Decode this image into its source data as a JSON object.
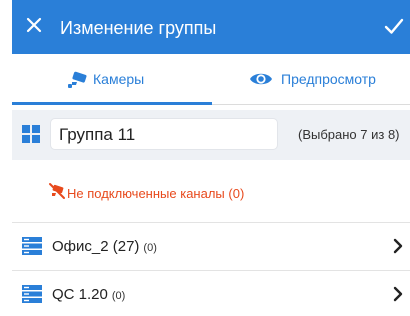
{
  "appbar": {
    "title": "Изменение группы",
    "background": "#2a7fd8"
  },
  "tabs": [
    {
      "label": "Камеры",
      "icon": "camera-icon",
      "selected": true
    },
    {
      "label": "Предпросмотр",
      "icon": "eye-icon",
      "selected": false
    }
  ],
  "group": {
    "name": "Группа 11",
    "selection_counter": "(Выбрано 7 из 8)"
  },
  "disconnected": {
    "label": "Не подключенные каналы (0)",
    "color": "#e84a1d"
  },
  "servers": [
    {
      "name": "Офис_2 (27)",
      "count": "(0)"
    },
    {
      "name": "QC 1.20",
      "count": "(0)"
    }
  ]
}
